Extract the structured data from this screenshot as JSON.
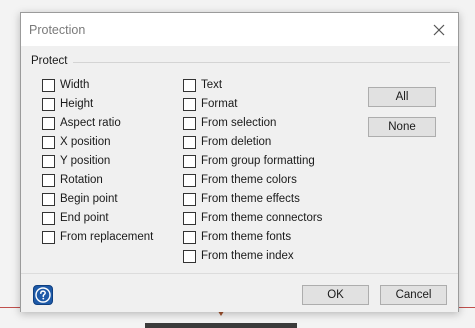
{
  "dialog": {
    "title": "Protection",
    "group_label": "Protect",
    "left_column": [
      {
        "label": "Width",
        "checked": false
      },
      {
        "label": "Height",
        "checked": false
      },
      {
        "label": "Aspect ratio",
        "checked": false
      },
      {
        "label": "X position",
        "checked": false
      },
      {
        "label": "Y position",
        "checked": false
      },
      {
        "label": "Rotation",
        "checked": false
      },
      {
        "label": "Begin point",
        "checked": false
      },
      {
        "label": "End point",
        "checked": false
      },
      {
        "label": "From replacement",
        "checked": false
      }
    ],
    "right_column": [
      {
        "label": "Text",
        "checked": false
      },
      {
        "label": "Format",
        "checked": false
      },
      {
        "label": "From selection",
        "checked": false
      },
      {
        "label": "From deletion",
        "checked": false
      },
      {
        "label": "From group formatting",
        "checked": false
      },
      {
        "label": "From theme colors",
        "checked": false
      },
      {
        "label": "From theme effects",
        "checked": false
      },
      {
        "label": "From theme connectors",
        "checked": false
      },
      {
        "label": "From theme fonts",
        "checked": false
      },
      {
        "label": "From theme index",
        "checked": false
      }
    ],
    "all_label": "All",
    "none_label": "None",
    "ok_label": "OK",
    "cancel_label": "Cancel",
    "icons": {
      "close": "close-icon",
      "help": "help-icon"
    }
  },
  "colors": {
    "help_blue": "#1e5aa8",
    "background_line": "#c0504d"
  }
}
